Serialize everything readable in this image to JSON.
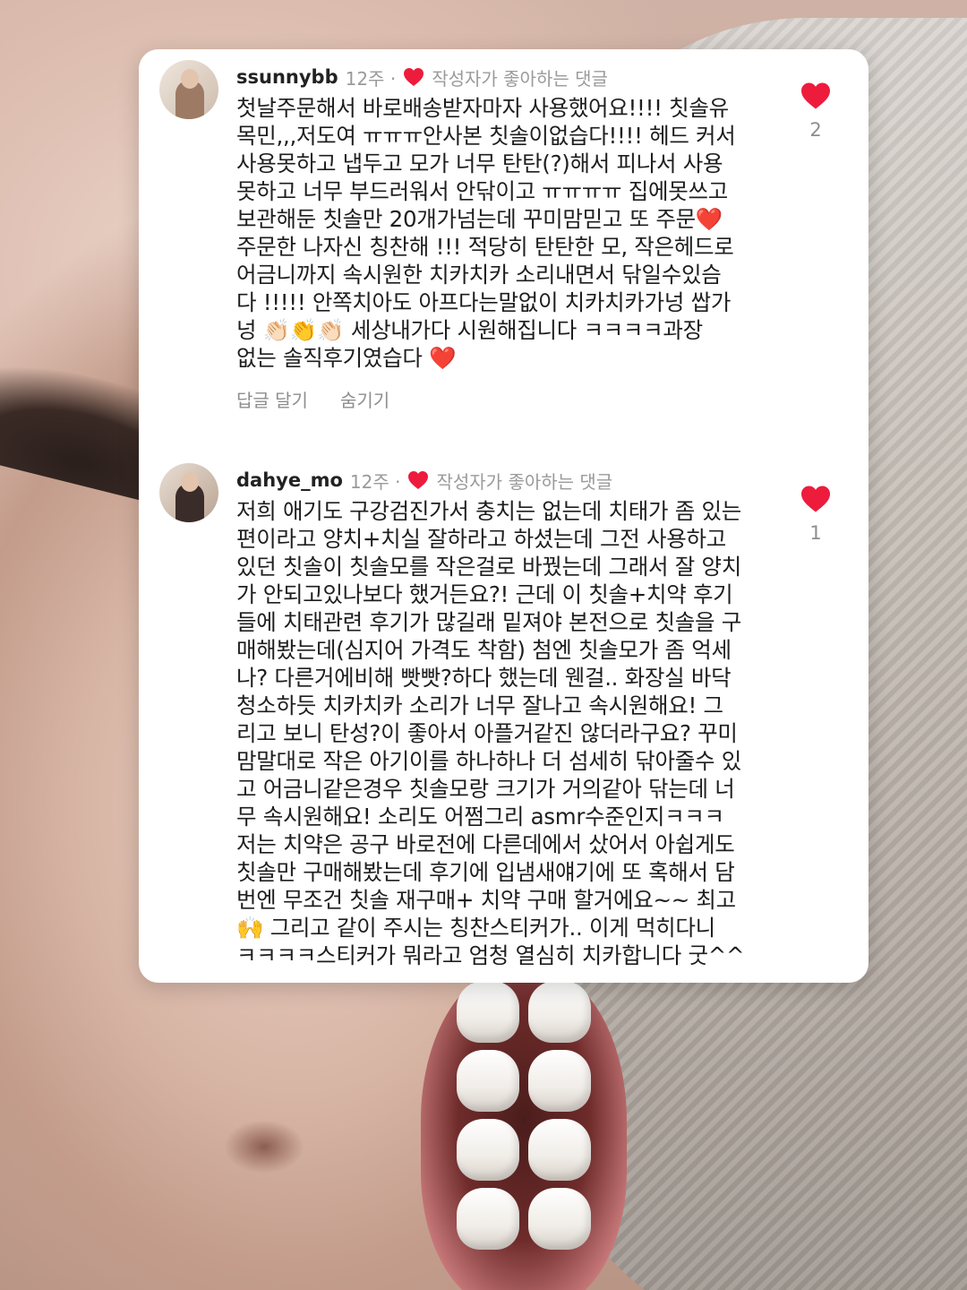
{
  "comments": [
    {
      "username": "ssunnybb",
      "time": "12주 ·",
      "author_liked_label": "작성자가 좋아하는 댓글",
      "lines": [
        "첫날주문해서 바로배송받자마자 사용했어요!!!! 칫솔유",
        "목민,,,저도여 ㅠㅠㅠ안사본 칫솔이없습다!!!! 헤드 커서",
        "사용못하고 냅두고 모가 너무 탄탄(?)해서 피나서 사용",
        "못하고 너무 부드러워서 안닦이고 ㅠㅠㅠㅠ 집에못쓰고",
        "보관해둔 칫솔만 20개가넘는데 꾸미맘믿고 또 주문❤️",
        "주문한 나자신 칭찬해 !!! 적당히 탄탄한 모, 작은헤드로",
        "어금니까지 속시원한 치카치카 소리내면서 닦일수있슴",
        "다 !!!!! 안쪽치아도 아프다는말없이 치카치카가넝 쌉가",
        "넝 👏🏻👏👏🏻 세상내가다 시원해집니다  ㅋㅋㅋㅋ과장",
        "없는 솔직후기였습다 ❤️"
      ],
      "reply_label": "답글 달기",
      "hide_label": "숨기기",
      "like_count": "2"
    },
    {
      "username": "dahye_mo",
      "time": "12주 ·",
      "author_liked_label": "작성자가 좋아하는 댓글",
      "lines": [
        "저희 애기도 구강검진가서 충치는 없는데 치태가 좀 있는",
        "편이라고 양치+치실 잘하라고 하셨는데 그전 사용하고",
        "있던 칫솔이 칫솔모를 작은걸로 바꿨는데 그래서 잘 양치",
        "가 안되고있나보다 했거든요?! 근데 이 칫솔+치약 후기",
        "들에 치태관련 후기가 많길래 밑져야 본전으로 칫솔을 구",
        "매해봤는데(심지어 가격도 착함) 첨엔 칫솔모가 좀 억세",
        "나? 다른거에비해 빳빳?하다 했는데 웬걸.. 화장실 바닥",
        "청소하듯 치카치카 소리가 너무 잘나고 속시원해요! 그",
        "리고 보니 탄성?이 좋아서 아플거같진 않더라구요? 꾸미",
        "맘말대로 작은 아기이를 하나하나 더 섬세히 닦아줄수 있",
        "고 어금니같은경우 칫솔모랑 크기가 거의같아 닦는데 너",
        "무 속시원해요! 소리도 어쩜그리 asmr수준인지ㅋㅋㅋ",
        "저는 치약은 공구 바로전에 다른데에서 샀어서 아쉽게도",
        "칫솔만 구매해봤는데 후기에 입냄새얘기에 또 혹해서 담",
        "번엔 무조건 칫솔 재구매+ 치약 구매 할거에요~~ 최고",
        "🙌 그리고 같이 주시는 칭찬스티커가.. 이게 먹히다니",
        "ㅋㅋㅋㅋ스티커가 뭐라고 엄청 열심히 치카합니다 굿^^"
      ],
      "like_count": "1"
    }
  ],
  "colors": {
    "heart": "#ed1c3d",
    "card": "#ffffff",
    "text": "#1e1e1e",
    "muted": "#8e8e8e"
  },
  "icons": {
    "liked_by_author": "heart-icon",
    "like": "heart-icon"
  }
}
